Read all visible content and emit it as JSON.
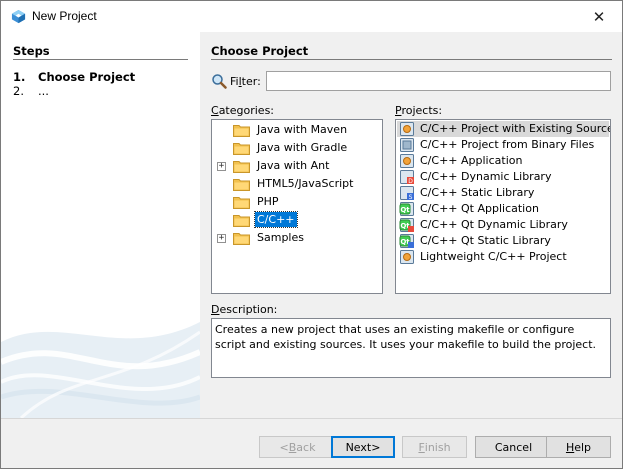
{
  "window": {
    "title": "New Project",
    "close_symbol": "✕"
  },
  "steps": {
    "title": "Steps",
    "items": [
      {
        "num": "1.",
        "label": "Choose Project"
      },
      {
        "num": "2.",
        "label": "..."
      }
    ]
  },
  "main": {
    "title": "Choose Project",
    "filter": {
      "label_pre": "Fi",
      "label_mnemonic": "l",
      "label_post": "ter:",
      "value": ""
    },
    "categories_label": {
      "mnemonic": "C",
      "rest": "ategories:"
    },
    "projects_label": {
      "mnemonic": "P",
      "rest": "rojects:"
    },
    "categories": [
      {
        "label": "Java with Maven",
        "expandable": false,
        "selected": false
      },
      {
        "label": "Java with Gradle",
        "expandable": false,
        "selected": false
      },
      {
        "label": "Java with Ant",
        "expandable": true,
        "selected": false
      },
      {
        "label": "HTML5/JavaScript",
        "expandable": false,
        "selected": false
      },
      {
        "label": "PHP",
        "expandable": false,
        "selected": false
      },
      {
        "label": "C/C++",
        "expandable": false,
        "selected": true
      },
      {
        "label": "Samples",
        "expandable": true,
        "selected": false
      }
    ],
    "projects": [
      {
        "label": "C/C++ Project with Existing Sources",
        "icon": "existing-sources-icon",
        "selected": true
      },
      {
        "label": "C/C++ Project from Binary Files",
        "icon": "binary-project-icon",
        "selected": false
      },
      {
        "label": "C/C++ Application",
        "icon": "application-icon",
        "selected": false
      },
      {
        "label": "C/C++ Dynamic Library",
        "icon": "dynamic-library-icon",
        "selected": false
      },
      {
        "label": "C/C++ Static Library",
        "icon": "static-library-icon",
        "selected": false
      },
      {
        "label": "C/C++ Qt Application",
        "icon": "qt-application-icon",
        "selected": false
      },
      {
        "label": "C/C++ Qt Dynamic Library",
        "icon": "qt-dynamic-library-icon",
        "selected": false
      },
      {
        "label": "C/C++ Qt Static Library",
        "icon": "qt-static-library-icon",
        "selected": false
      },
      {
        "label": "Lightweight C/C++ Project",
        "icon": "lightweight-project-icon",
        "selected": false
      }
    ],
    "description_label": {
      "mnemonic": "D",
      "rest": "escription:"
    },
    "description": "Creates a new project that uses an existing makefile or configure script and existing sources. It uses your makefile to build the project."
  },
  "buttons": {
    "back": {
      "pre": "< ",
      "mnemonic": "B",
      "post": "ack",
      "enabled": false
    },
    "next": {
      "pre": "Next ",
      "mnemonic": "",
      "post": ">",
      "enabled": true
    },
    "finish": {
      "pre": "",
      "mnemonic": "F",
      "post": "inish",
      "enabled": false
    },
    "cancel": {
      "pre": "Cancel",
      "mnemonic": "",
      "post": "",
      "enabled": true
    },
    "help": {
      "pre": "",
      "mnemonic": "H",
      "post": "elp",
      "enabled": true
    }
  },
  "colors": {
    "selection": "#0078d7",
    "project_highlight": "#d9d9d9",
    "folder": "#f2c14e"
  }
}
